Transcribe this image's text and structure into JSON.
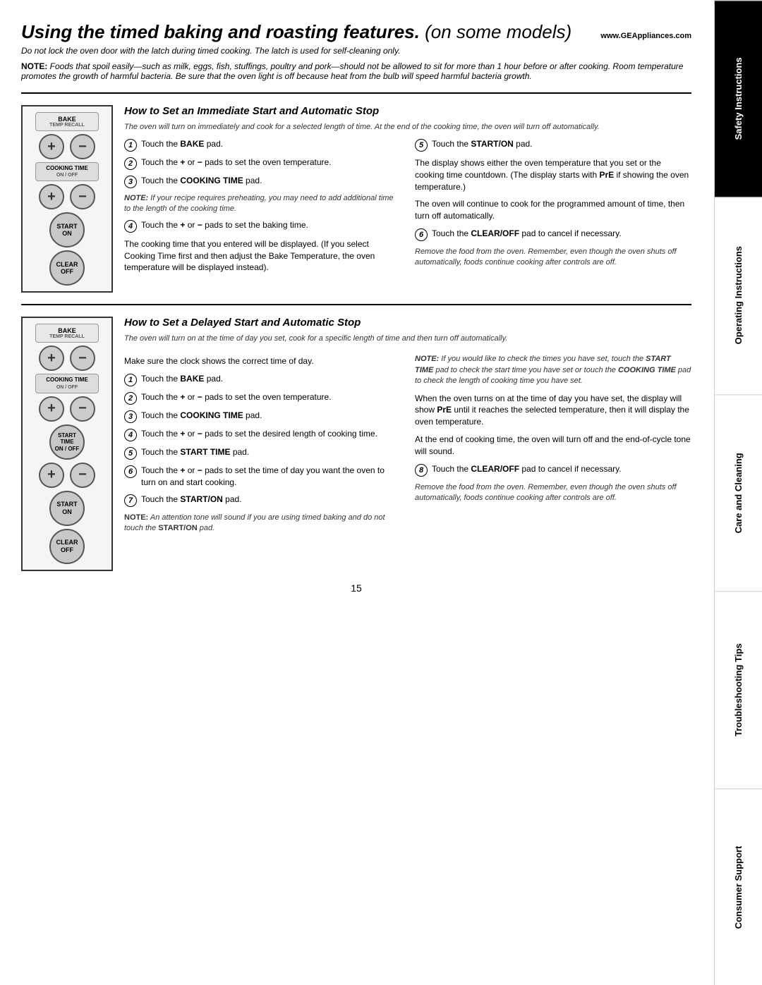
{
  "page": {
    "number": "15",
    "website": "www.GEAppliances.com"
  },
  "header": {
    "main_title": "Using the timed baking and roasting features.",
    "main_title_suffix": " (on some models)",
    "subtitle": "Do not lock the oven door with the latch during timed cooking. The latch is used for self-cleaning only.",
    "note_label": "NOTE:",
    "note_text": " Foods that spoil easily—such as milk, eggs, fish, stuffings, poultry and pork—should not be allowed to sit for more than 1 hour before or after cooking. Room temperature promotes the growth of harmful bacteria. Be sure that the oven light is off because heat from the bulb will speed harmful bacteria growth."
  },
  "sidebar": {
    "sections": [
      {
        "id": "safety",
        "label": "Safety Instructions",
        "dark": true
      },
      {
        "id": "operating",
        "label": "Operating Instructions",
        "dark": false
      },
      {
        "id": "care",
        "label": "Care and Cleaning",
        "dark": false
      },
      {
        "id": "troubleshooting",
        "label": "Troubleshooting Tips",
        "dark": false
      },
      {
        "id": "consumer",
        "label": "Consumer Support",
        "dark": false
      }
    ]
  },
  "section_immediate": {
    "title": "How to Set an Immediate Start and Automatic Stop",
    "intro": "The oven will turn on immediately and cook for a selected length of time. At the end of the cooking time, the oven will turn off automatically.",
    "panel": {
      "bake_label": "BAKE",
      "bake_sublabel": "TEMP RECALL",
      "cooking_time_label": "COOKING TIME",
      "cooking_time_sublabel": "ON / OFF",
      "start_label": "START",
      "start_sublabel": "ON",
      "clear_label": "CLEAR",
      "clear_sublabel": "OFF"
    },
    "col_left": {
      "steps": [
        {
          "num": "1",
          "text": "Touch the BAKE pad."
        },
        {
          "num": "2",
          "text": "Touch the + or − pads to set the oven temperature."
        },
        {
          "num": "3",
          "text": "Touch the COOKING TIME pad."
        }
      ],
      "note": "NOTE: If your recipe requires preheating, you may need to add additional time to the length of the cooking time.",
      "step4": {
        "num": "4",
        "text": "Touch the + or − pads to set the baking time."
      },
      "cooking_time_note": "The cooking time that you entered will be displayed. (If you select Cooking Time first and then adjust the Bake Temperature, the oven temperature will be displayed instead)."
    },
    "col_right": {
      "step5": {
        "num": "5",
        "text": "Touch the START/ON pad."
      },
      "display_note": "The display shows either the oven temperature that you set or the cooking time countdown. (The display starts with PrE if showing the oven temperature.)",
      "continue_note": "The oven will continue to cook for the programmed amount of time, then turn off automatically.",
      "step6": {
        "num": "6",
        "text": "Touch the CLEAR/OFF pad to cancel if necessary."
      },
      "remove_note": "Remove the food from the oven. Remember, even though the oven shuts off automatically, foods continue cooking after controls are off."
    }
  },
  "section_delayed": {
    "title": "How to Set a Delayed Start and Automatic Stop",
    "intro": "The oven will turn on at the time of day you set, cook for a specific length of time and then turn off automatically.",
    "panel": {
      "bake_label": "BAKE",
      "bake_sublabel": "TEMP RECALL",
      "cooking_time_label": "COOKING TIME",
      "cooking_time_sublabel": "ON / OFF",
      "start_time_label": "START TIME",
      "start_time_sublabel": "ON / OFF",
      "start_label": "START",
      "start_sublabel": "ON",
      "clear_label": "CLEAR",
      "clear_sublabel": "OFF"
    },
    "col_left": {
      "make_sure": "Make sure the clock shows the correct time of day.",
      "steps": [
        {
          "num": "1",
          "text": "Touch the BAKE pad."
        },
        {
          "num": "2",
          "text": "Touch the + or − pads to set the oven temperature."
        },
        {
          "num": "3",
          "text": "Touch the COOKING TIME pad."
        },
        {
          "num": "4",
          "text": "Touch the + or − pads to set the desired length of cooking time."
        },
        {
          "num": "5",
          "text": "Touch the START TIME pad."
        },
        {
          "num": "6",
          "text": "Touch the + or − pads to set the time of day you want the oven to turn on and start cooking."
        },
        {
          "num": "7",
          "text": "Touch the START/ON pad."
        }
      ],
      "bottom_note_label": "NOTE:",
      "bottom_note": " An attention tone will sound if you are using timed baking and do not touch the ",
      "bottom_note_bold": "START/ON",
      "bottom_note_end": " pad."
    },
    "col_right": {
      "note_label": "NOTE:",
      "note_text": " If you would like to check the times you have set, touch the START TIME pad to check the start time you have set or touch the COOKING TIME pad to check the length of cooking time you have set.",
      "display_note": "When the oven turns on at the time of day you have set, the display will show PrE until it reaches the selected temperature, then it will display the oven temperature.",
      "end_note": "At the end of cooking time, the oven will turn off and the end-of-cycle tone will sound.",
      "step8": {
        "num": "8",
        "text": "Touch the CLEAR/OFF pad to cancel if necessary."
      },
      "remove_note": "Remove the food from the oven. Remember, even though the oven shuts off automatically, foods continue cooking after controls are off."
    }
  }
}
